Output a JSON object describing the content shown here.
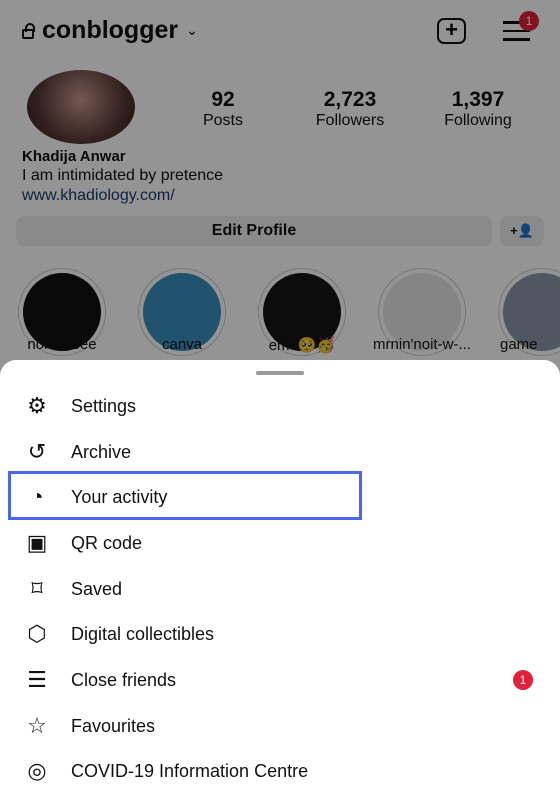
{
  "header": {
    "username": "conblogger",
    "menu_badge": "1"
  },
  "profile": {
    "posts": "92",
    "posts_label": "Posts",
    "followers": "2,723",
    "followers_label": "Followers",
    "following": "1,397",
    "following_label": "Following",
    "name": "Khadija Anwar",
    "bio": "I am intimidated by pretence",
    "link": "www.khadiology.com/",
    "edit_label": "Edit Profile"
  },
  "highlights": [
    "noiceeeee",
    "canva",
    "emo🥺🥳",
    "mrnin'noit-w-...",
    "game"
  ],
  "sheet": {
    "items": [
      {
        "label": "Settings",
        "icon": "settings-icon"
      },
      {
        "label": "Archive",
        "icon": "archive-icon"
      },
      {
        "label": "Your activity",
        "icon": "activity-icon"
      },
      {
        "label": "QR code",
        "icon": "qr-code-icon"
      },
      {
        "label": "Saved",
        "icon": "bookmark-icon"
      },
      {
        "label": "Digital collectibles",
        "icon": "collectibles-icon"
      },
      {
        "label": "Close friends",
        "icon": "close-friends-icon",
        "badge": "1"
      },
      {
        "label": "Favourites",
        "icon": "star-icon"
      },
      {
        "label": "COVID-19 Information Centre",
        "icon": "covid-info-icon"
      }
    ]
  },
  "colors": {
    "highlight": "#4a68ef",
    "badge": "#e0213a"
  }
}
